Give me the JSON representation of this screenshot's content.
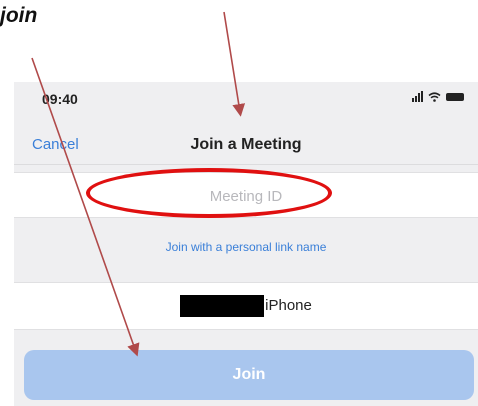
{
  "annotation": {
    "text": "join"
  },
  "status_bar": {
    "time": "09:40",
    "icons": [
      "signal-icon",
      "wifi-icon",
      "battery-icon"
    ]
  },
  "nav": {
    "cancel_label": "Cancel",
    "title": "Join a Meeting"
  },
  "meeting_id": {
    "placeholder": "Meeting ID",
    "value": ""
  },
  "personal_link_label": "Join with a personal link name",
  "name_field": {
    "visible_suffix": "iPhone",
    "redacted": true
  },
  "join_button": {
    "label": "Join",
    "enabled": false
  },
  "colors": {
    "accent": "#3a7fd8",
    "join_disabled": "#a9c6ee",
    "annotation": "#e01010",
    "arrow": "#b04a4a"
  }
}
